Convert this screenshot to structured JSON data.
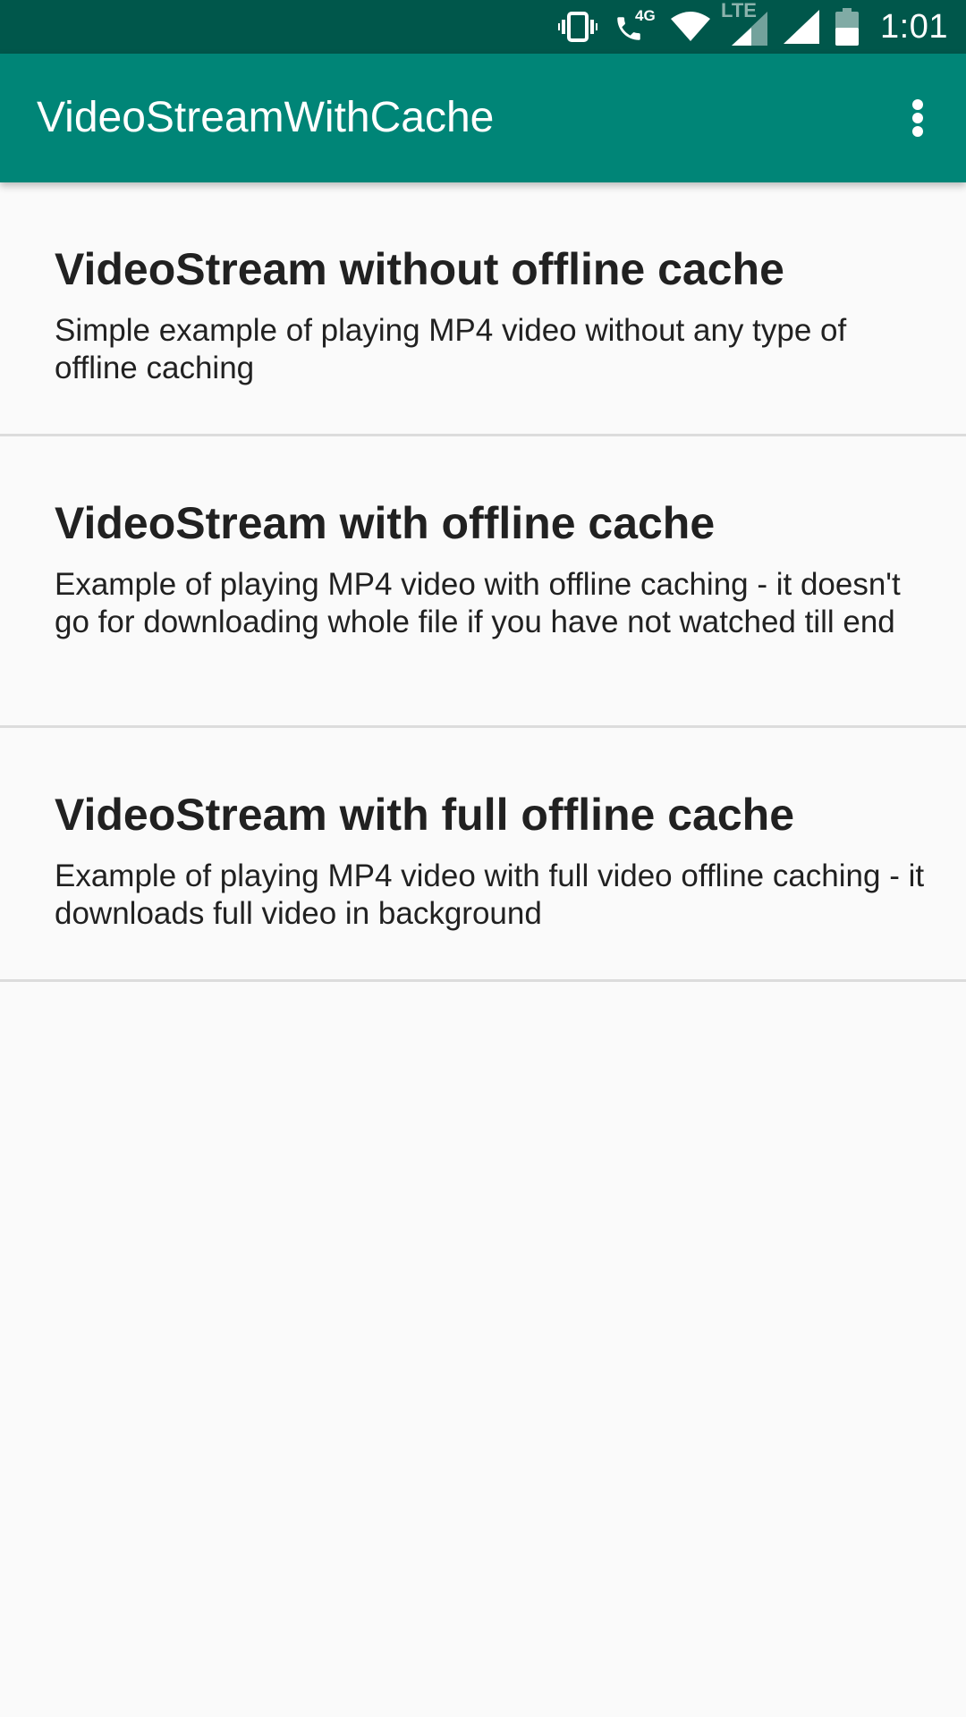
{
  "status_bar": {
    "time": "1:01",
    "network_label": "4G",
    "lte_label": "LTE"
  },
  "app_bar": {
    "title": "VideoStreamWithCache"
  },
  "list": {
    "items": [
      {
        "title": "VideoStream without offline cache",
        "description": "Simple example of playing MP4 video without any type of offline caching"
      },
      {
        "title": "VideoStream with offline cache",
        "description": "Example of playing MP4 video with offline caching - it doesn't go for downloading whole file if you have not watched till end"
      },
      {
        "title": "VideoStream with full offline cache",
        "description": "Example of playing MP4 video with full video offline caching - it downloads full video in background"
      }
    ]
  },
  "colors": {
    "status_bar": "#00574b",
    "app_bar": "#008577",
    "background": "#fafafa",
    "text": "#212121",
    "divider": "#dcdcdc"
  }
}
